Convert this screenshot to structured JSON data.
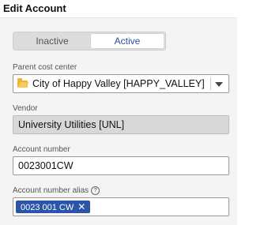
{
  "header": {
    "title": "Edit Account"
  },
  "status_toggle": {
    "inactive_label": "Inactive",
    "active_label": "Active",
    "selected": "Active"
  },
  "parent_cost_center": {
    "label": "Parent cost center",
    "value": "City of Happy Valley [HAPPY_VALLEY]",
    "icon": "folder-icon"
  },
  "vendor": {
    "label": "Vendor",
    "value": "University Utilities [UNL]"
  },
  "account_number": {
    "label": "Account number",
    "value": "0023001CW"
  },
  "account_number_alias": {
    "label": "Account number alias",
    "help_icon": "?",
    "tags": [
      "0023 001 CW"
    ],
    "remove_glyph": "✕"
  },
  "colors": {
    "accent": "#2a55a8",
    "readonly_bg": "#d8d8d8",
    "panel_bg": "#f4f4f4"
  }
}
